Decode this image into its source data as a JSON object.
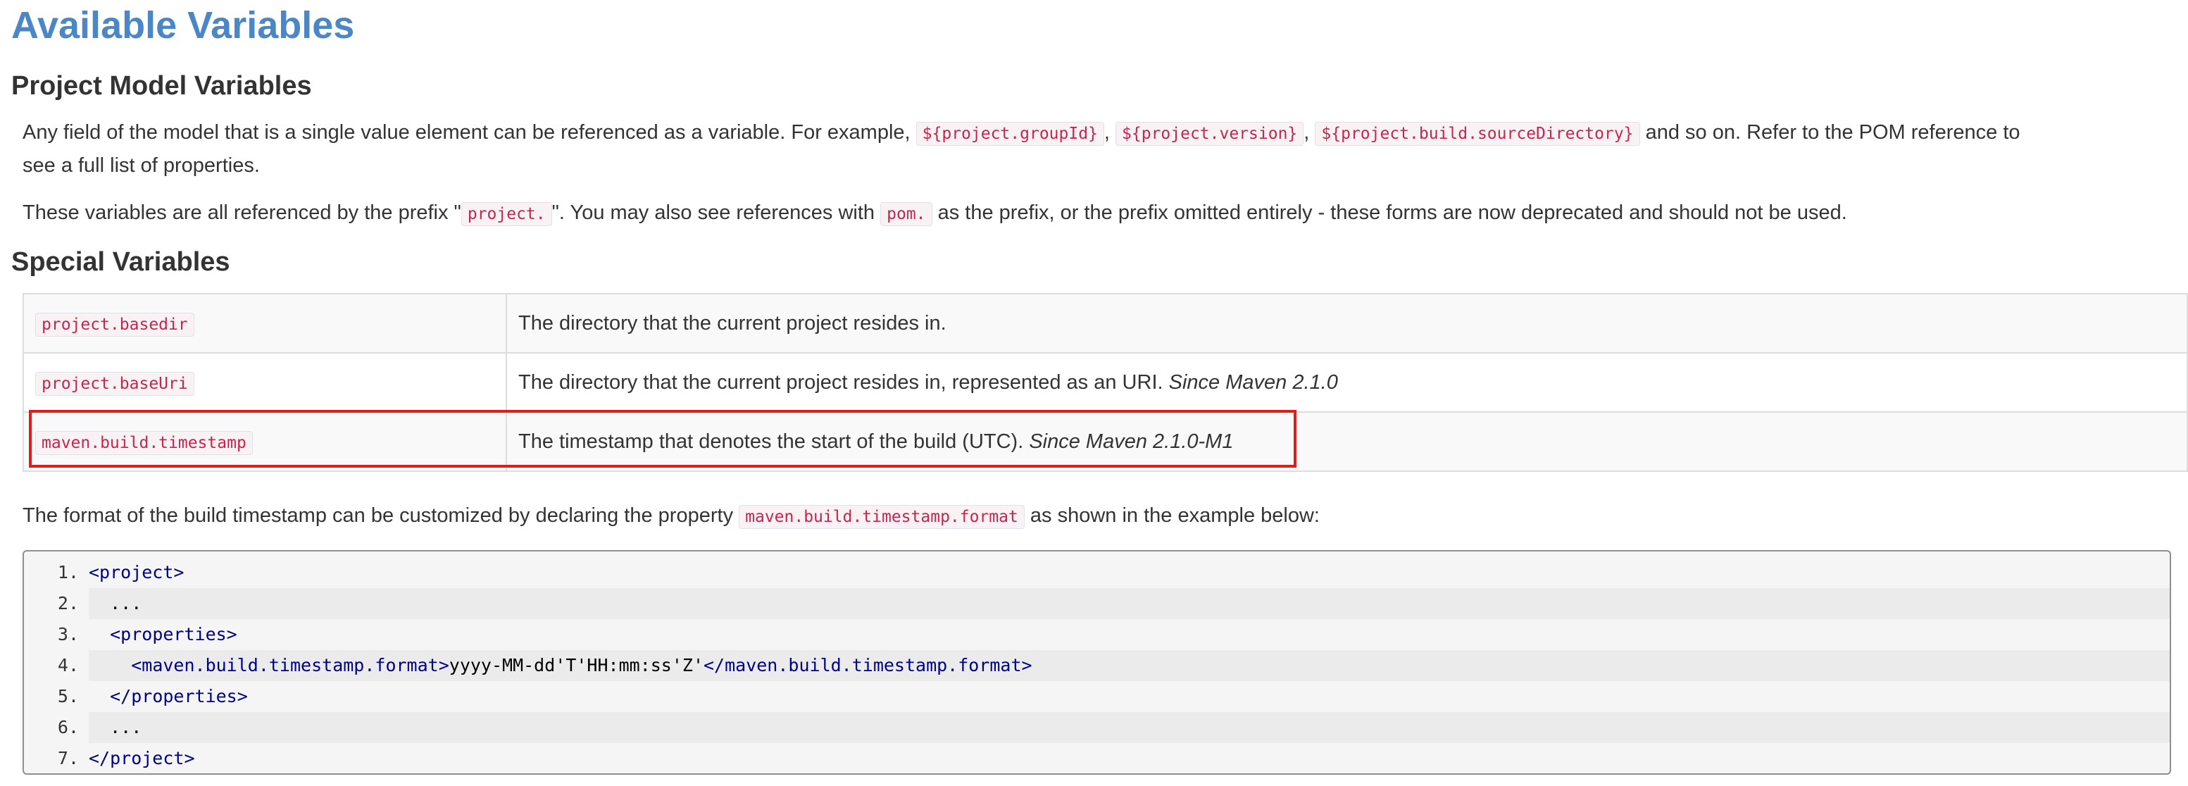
{
  "title": "Available Variables",
  "sections": {
    "project_model": "Project Model Variables",
    "special": "Special Variables"
  },
  "para1": {
    "before": "Any field of the model that is a single value element can be referenced as a variable. For example, ",
    "code1": "${project.groupId}",
    "sep1": ", ",
    "code2": "${project.version}",
    "sep2": ", ",
    "code3": "${project.build.sourceDirectory}",
    "after": " and so on. Refer to the POM reference to",
    "line2": "see a full list of properties."
  },
  "para2": {
    "before": "These variables are all referenced by the prefix \"",
    "code1": "project.",
    "mid": "\". You may also see references with ",
    "code2": "pom.",
    "after": " as the prefix, or the prefix omitted entirely - these forms are now deprecated and should not be used."
  },
  "table": {
    "rows": [
      {
        "key": "project.basedir",
        "desc": "The directory that the current project resides in.",
        "since": ""
      },
      {
        "key": "project.baseUri",
        "desc": "The directory that the current project resides in, represented as an URI. ",
        "since": "Since Maven 2.1.0"
      },
      {
        "key": "maven.build.timestamp",
        "desc": "The timestamp that denotes the start of the build (UTC). ",
        "since": "Since Maven 2.1.0-M1"
      }
    ]
  },
  "para3": {
    "before": "The format of the build timestamp can be customized by declaring the property ",
    "code1": "maven.build.timestamp.format",
    "after": " as shown in the example below:"
  },
  "code_block": {
    "lines": [
      {
        "num": "1.",
        "indent": "",
        "open": "<project>",
        "text": "",
        "close": ""
      },
      {
        "num": "2.",
        "indent": "  ",
        "open": "",
        "text": "...",
        "close": ""
      },
      {
        "num": "3.",
        "indent": "  ",
        "open": "<properties>",
        "text": "",
        "close": ""
      },
      {
        "num": "4.",
        "indent": "    ",
        "open": "<maven.build.timestamp.format>",
        "text": "yyyy-MM-dd'T'HH:mm:ss'Z'",
        "close": "</maven.build.timestamp.format>"
      },
      {
        "num": "5.",
        "indent": "  ",
        "open": "</properties>",
        "text": "",
        "close": ""
      },
      {
        "num": "6.",
        "indent": "  ",
        "open": "",
        "text": "...",
        "close": ""
      },
      {
        "num": "7.",
        "indent": "",
        "open": "</project>",
        "text": "",
        "close": ""
      }
    ]
  },
  "colors": {
    "title": "#4b86c6",
    "inline_code": "#c7254e",
    "highlight_border": "#e21b1b",
    "xml_tag": "#000088"
  }
}
